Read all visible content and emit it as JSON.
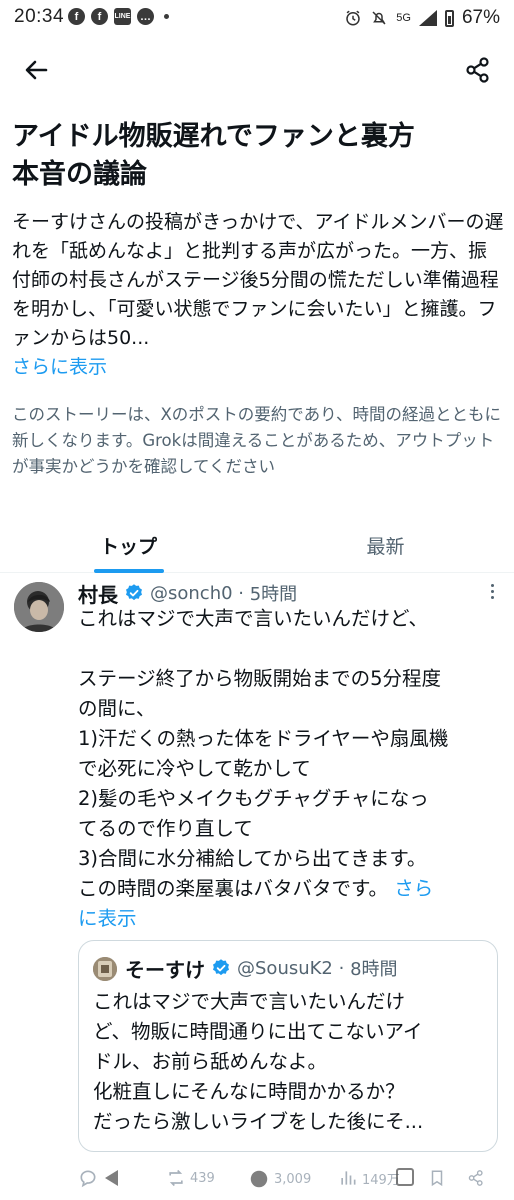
{
  "status_bar": {
    "time": "20:34",
    "network": "5G",
    "battery": "67%"
  },
  "story": {
    "title_line1": "アイドル物販遅れでファンと裏方",
    "title_line2": "本音の議論",
    "summary": "そーすけさんの投稿がきっかけで、アイドルメンバーの遅れを「舐めんなよ」と批判する声が広がった。一方、振付師の村長さんがステージ後5分間の慌ただしい準備過程を明かし、「可愛い状態でファンに会いたい」と擁護。ファンからは50...",
    "show_more": "さらに表示",
    "disclaimer": "このストーリーは、Xのポストの要約であり、時間の経過とともに新しくなります。Grokは間違えることがあるため、アウトプットが事実かどうかを確認してください"
  },
  "tabs": [
    {
      "label": "トップ",
      "selected": true
    },
    {
      "label": "最新",
      "selected": false
    }
  ],
  "post": {
    "author_name": "村長",
    "handle": "@sonch0",
    "time": "5時間",
    "lines": [
      "これはマジで大声で言いたいんだけど、",
      "",
      "ステージ終了から物販開始までの5分程度",
      "の間に、",
      "1)汗だくの熱った体をドライヤーや扇風機",
      "で必死に冷やして乾かして",
      "2)髪の毛やメイクもグチャグチャになっ",
      "てるので作り直して",
      "3)合間に水分補給してから出てきます。",
      "この時間の楽屋裏はバタバタです。"
    ],
    "show_more_1": "さら",
    "show_more_2": "に表示"
  },
  "quote": {
    "author_name": "そーすけ",
    "handle": "@SousuK2",
    "time": "8時間",
    "lines": [
      "これはマジで大声で言いたいんだけ",
      "ど、物販に時間通りに出てこないアイ",
      "ドル、お前ら舐めんなよ。",
      "化粧直しにそんなに時間かかるか？",
      "だったら激しいライブをした後にそ..."
    ]
  },
  "actions": {
    "reposts": "439",
    "likes": "3,009",
    "views": "149万"
  },
  "icons": {
    "back": "arrow-left-icon",
    "share": "share-icon",
    "verified": "verified-badge-icon",
    "more": "more-vertical-icon",
    "reply": "reply-icon",
    "repost": "repost-icon",
    "like": "like-icon",
    "views": "views-icon",
    "bookmark": "bookmark-icon"
  },
  "colors": {
    "accent": "#1d9bf0",
    "text": "#0f1419",
    "secondary": "#536471"
  }
}
